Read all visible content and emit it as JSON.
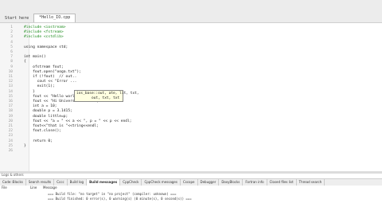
{
  "tabs": [
    {
      "label": "Start here"
    },
    {
      "label": "*Hello_IO.cpp"
    }
  ],
  "file_title": "~ Hello_IO.cpp",
  "code_lines": [
    {
      "n": "1",
      "text": "#include <iostream>"
    },
    {
      "n": "2",
      "text": "#include <fstream>"
    },
    {
      "n": "3",
      "text": "#include <cstdlib>"
    },
    {
      "n": "4",
      "text": ""
    },
    {
      "n": "5",
      "text": "using namespace std;"
    },
    {
      "n": "6",
      "text": ""
    },
    {
      "n": "7",
      "text": "int main()"
    },
    {
      "n": "8",
      "text": "{"
    },
    {
      "n": "9",
      "text": "    ofstream fout;"
    },
    {
      "n": "10",
      "text": "    fout.open(\"ooga.txt\");"
    },
    {
      "n": "11",
      "text": "    if (!fout)  // out.."
    },
    {
      "n": "12",
      "text": "      cout << \"Error ..."
    },
    {
      "n": "13",
      "text": "      exit(1);"
    },
    {
      "n": "14",
      "text": "    }"
    },
    {
      "n": "15",
      "text": "    fout << \"Hello world!\" << endl;"
    },
    {
      "n": "16",
      "text": "    fout << \"Hi Universe\" << endl;"
    },
    {
      "n": "17",
      "text": "    int a = 10;"
    },
    {
      "n": "18",
      "text": "    double p = 3.1415;"
    },
    {
      "n": "19",
      "text": "    double little=p;"
    },
    {
      "n": "20",
      "text": "    fout << \"a = \" << a << \", p = \" << p << endl;"
    },
    {
      "n": "21",
      "text": "    fout<<\"that is \"<<tring<<endl;"
    },
    {
      "n": "22",
      "text": "    fout.close();"
    },
    {
      "n": "23",
      "text": ""
    },
    {
      "n": "24",
      "text": "    return 0;"
    },
    {
      "n": "25",
      "text": "}"
    },
    {
      "n": "26",
      "text": ""
    }
  ],
  "tooltip": {
    "line1": "ios_base::out, ate, lit, txt,",
    "line2": "       out, txt, txt"
  },
  "logs_label": "Logs & others",
  "log_tabs": [
    {
      "label": "Code::Blocks"
    },
    {
      "label": "Search results"
    },
    {
      "label": "Cccc"
    },
    {
      "label": "Build log"
    },
    {
      "label": "Build messages"
    },
    {
      "label": "CppCheck"
    },
    {
      "label": "CppCheck messages"
    },
    {
      "label": "Cscope"
    },
    {
      "label": "Debugger"
    },
    {
      "label": "DoxyBlocks"
    },
    {
      "label": "Fortran info"
    },
    {
      "label": "Closed files list"
    },
    {
      "label": "Thread search"
    }
  ],
  "log_header": {
    "file": "File",
    "line": "Line",
    "message": "Message"
  },
  "log_lines": [
    "=== Build file: \"no target\" in \"no project\" (compiler: unknown) ===",
    "=== Build finished: 0 error(s), 0 warning(s) (0 minute(s), 0 second(s)) ==="
  ]
}
